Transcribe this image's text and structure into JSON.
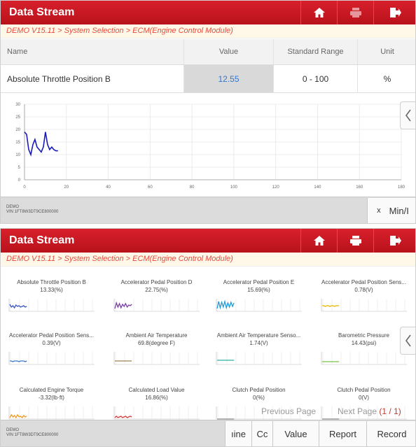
{
  "colors": {
    "titlebar": "#c4161f",
    "breadcrumb": "#e84b3c",
    "value_text": "#2e78d8",
    "series": "#1a1ab8"
  },
  "screen1": {
    "title": "Data Stream",
    "breadcrumb": "DEMO V15.11 > System Selection > ECM(Engine Control Module)",
    "columns": {
      "name": "Name",
      "value": "Value",
      "range": "Standard Range",
      "unit": "Unit"
    },
    "row": {
      "name": "Absolute Throttle Position B",
      "value": "12.55",
      "range": "0 - 100",
      "unit": "%"
    },
    "chart_data": {
      "type": "line",
      "x": [
        0,
        1,
        2,
        3,
        4,
        5,
        6,
        7,
        8,
        9,
        10,
        11,
        12,
        13,
        14,
        15,
        16
      ],
      "values": [
        19,
        18,
        12,
        10,
        14,
        16,
        13,
        12,
        11,
        13,
        19,
        14,
        12,
        13,
        12,
        11.5,
        11.5
      ],
      "xlim": [
        0,
        180
      ],
      "ylim": [
        0,
        30
      ],
      "xticks": [
        "0",
        "20",
        "40",
        "60",
        "80",
        "100",
        "120",
        "140",
        "160",
        "180"
      ],
      "yticks": [
        "30",
        "25",
        "20",
        "15",
        "10",
        "5",
        "0"
      ],
      "grid": true
    },
    "footer": {
      "demo": "DEMO",
      "vin": "VIN 1FT8W3DT9CE800000"
    },
    "buttons": {
      "x": "x",
      "minmax": "Min/I"
    }
  },
  "screen2": {
    "title": "Data Stream",
    "breadcrumb": "DEMO V15.11 > System Selection > ECM(Engine Control Module)",
    "tiles": [
      {
        "name": "Absolute Throttle Position B",
        "value": "13.33(%)",
        "color": "#3a56c8"
      },
      {
        "name": "Accelerator Pedal Position D",
        "value": "22.75(%)",
        "color": "#7b3fa8"
      },
      {
        "name": "Accelerator Pedal Position E",
        "value": "15.69(%)",
        "color": "#1e9bd7"
      },
      {
        "name": "Accelerator Pedal Position Sens...",
        "value": "0.78(V)",
        "color": "#e6b800"
      },
      {
        "name": "Accelerator Pedal Position Sens...",
        "value": "0.39(V)",
        "color": "#3a78c8"
      },
      {
        "name": "Ambient Air Temperature",
        "value": "69.8(degree F)",
        "color": "#a08050"
      },
      {
        "name": "Ambient Air Temperature Senso...",
        "value": "1.74(V)",
        "color": "#2ab0a0"
      },
      {
        "name": "Barometric Pressure",
        "value": "14.43(psi)",
        "color": "#7ac143"
      },
      {
        "name": "Calculated Engine Torque",
        "value": "-3.32(lb·ft)",
        "color": "#f09a20"
      },
      {
        "name": "Calculated Load Value",
        "value": "16.86(%)",
        "color": "#d83a3a"
      },
      {
        "name": "Clutch Pedal Position",
        "value": "0(%)",
        "color": "#888888"
      },
      {
        "name": "Clutch Pedal Position",
        "value": "0(V)",
        "color": "#888888"
      }
    ],
    "pager": {
      "prev": "Previous Page",
      "next": "Next Page",
      "page": "(1 / 1)"
    },
    "footer": {
      "demo": "DEMO",
      "vin": "VIN 1FT8W3DT9CE800000"
    },
    "buttons": {
      "engine": "ıine",
      "cc": "Cc",
      "value": "Value",
      "report": "Report",
      "record": "Record"
    }
  }
}
